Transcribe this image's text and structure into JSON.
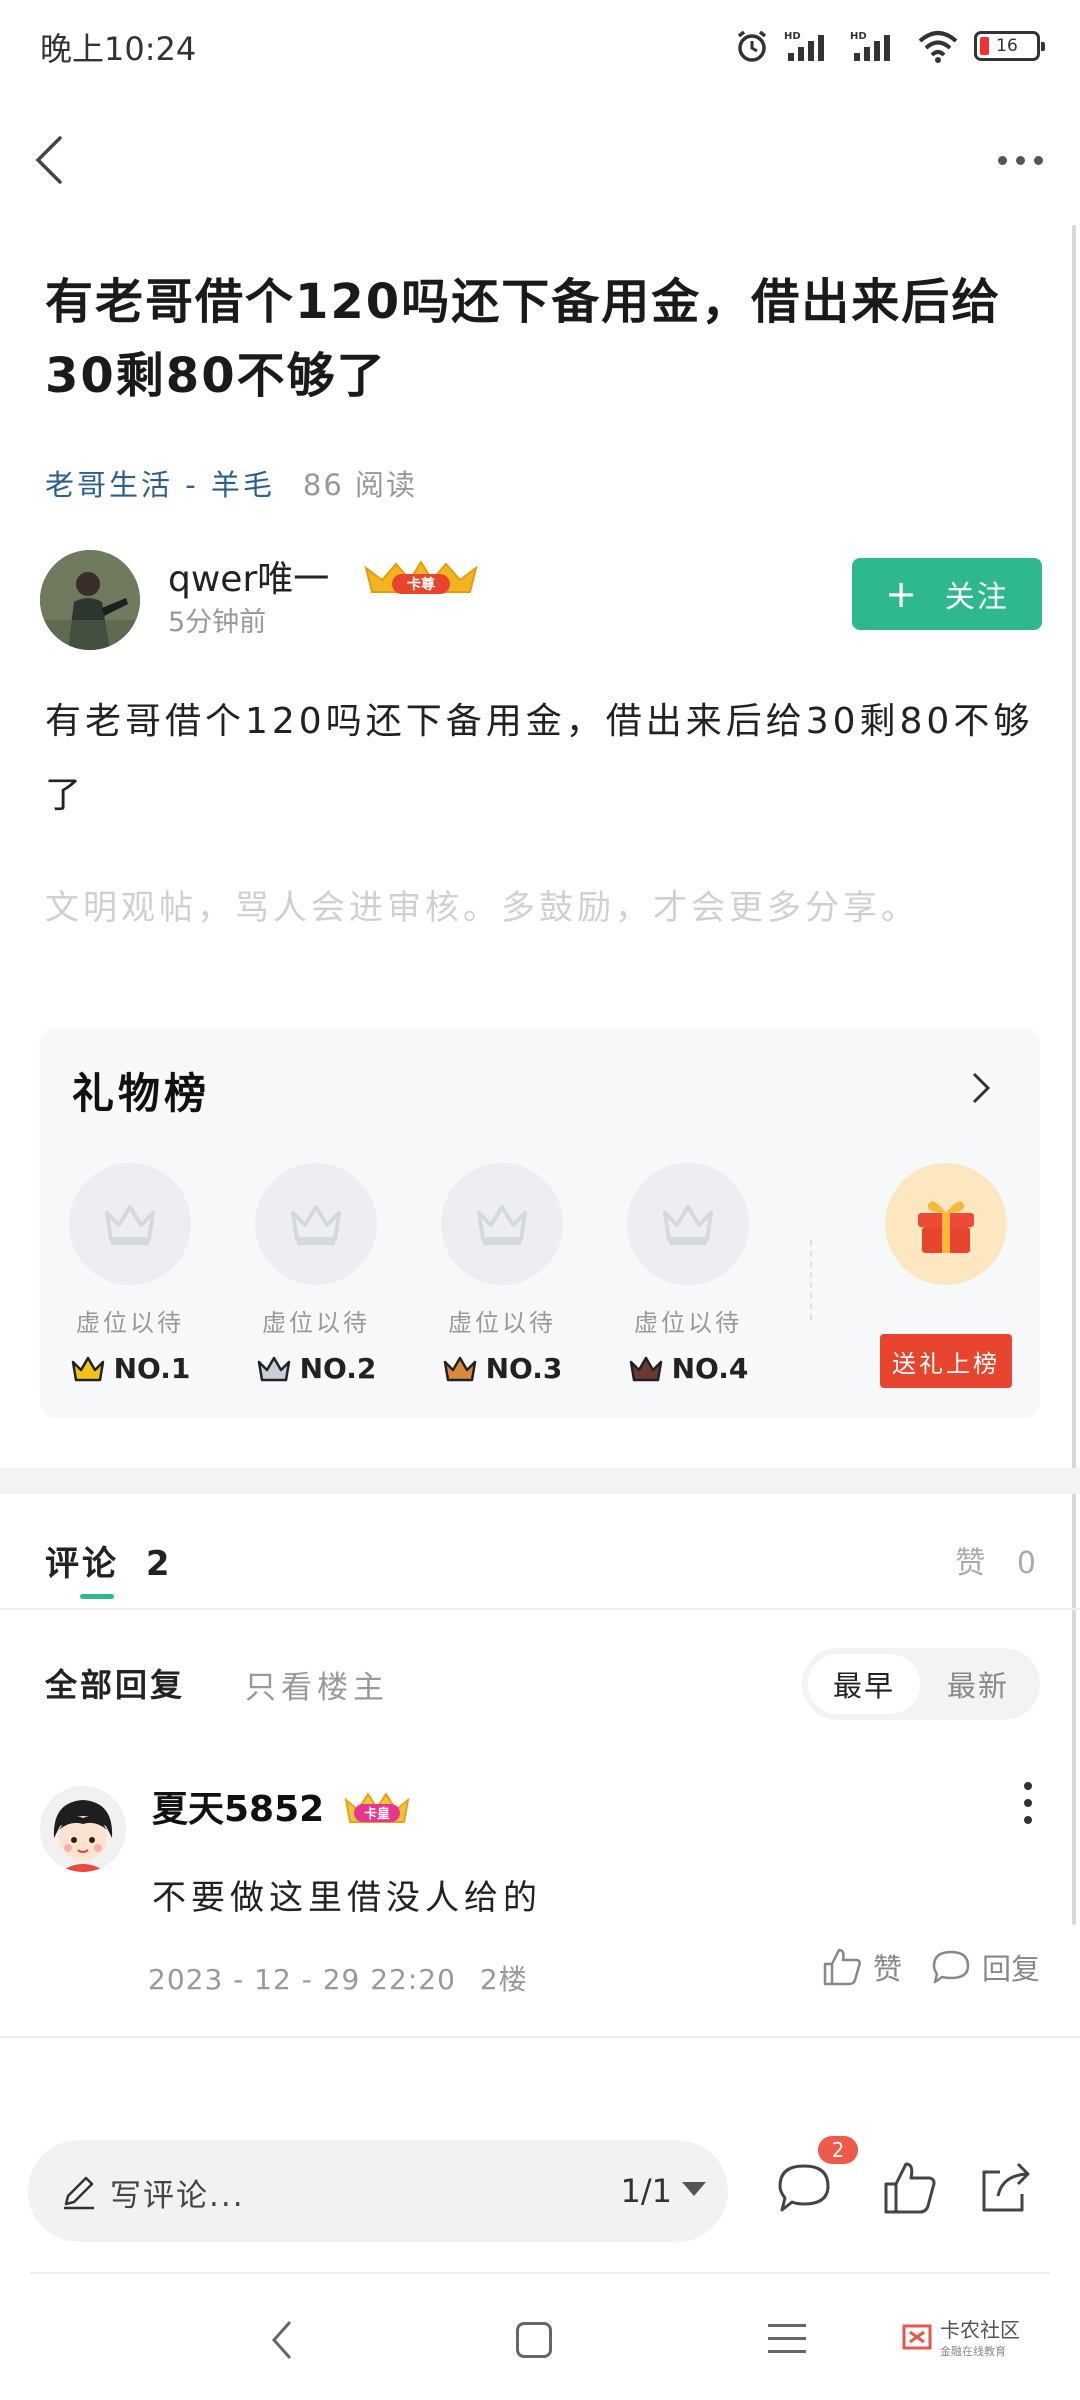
{
  "status_bar": {
    "time": "晚上10:24",
    "battery": "16",
    "icons": [
      "alarm-icon",
      "signal-hd-icon",
      "signal-hd-icon",
      "wifi-icon",
      "battery-icon"
    ]
  },
  "nav": {
    "back_icon": "back-chevron-icon",
    "more_icon": "more-dots-icon"
  },
  "post": {
    "title": "有老哥借个120吗还下备用金，借出来后给30剩80不够了",
    "category": "老哥生活 - 羊毛",
    "reads": "86 阅读",
    "author": "qwer唯一",
    "author_badge": "卡尊",
    "time_ago": "5分钟前",
    "follow_label": "关注",
    "follow_plus": "+",
    "body": "有老哥借个120吗还下备用金，借出来后给30剩80不够了",
    "civility_note": "文明观帖，骂人会进审核。多鼓励，才会更多分享。"
  },
  "gift_board": {
    "title": "礼物榜",
    "slots": [
      {
        "placeholder": "虚位以待",
        "rank": "NO.1",
        "crown_color": "#f3c11b"
      },
      {
        "placeholder": "虚位以待",
        "rank": "NO.2",
        "crown_color": "#c9cfd8"
      },
      {
        "placeholder": "虚位以待",
        "rank": "NO.3",
        "crown_color": "#d88a3c"
      },
      {
        "placeholder": "虚位以待",
        "rank": "NO.4",
        "crown_color": "#6b3a34"
      }
    ],
    "send_label": "送礼上榜"
  },
  "comments": {
    "tab_label": "评论",
    "count": "2",
    "likes_label": "赞",
    "likes_count": "0",
    "filter_all": "全部回复",
    "filter_op": "只看楼主",
    "sort_earliest": "最早",
    "sort_latest": "最新",
    "items": [
      {
        "user": "夏天5852",
        "badge": "卡皇",
        "text": "不要做这里借没人给的",
        "time": "2023 - 12 - 29 22:20",
        "floor": "2楼",
        "like_label": "赞",
        "reply_label": "回复"
      }
    ]
  },
  "bottom_bar": {
    "write_placeholder": "写评论...",
    "page": "1/1",
    "comment_badge": "2"
  },
  "watermark": {
    "main": "卡农社区",
    "sub": "金融在线教育"
  },
  "colors": {
    "accent": "#2fb890",
    "category_link": "#2e5f8a",
    "send_gift": "#e8452f",
    "badge_red": "#ee5a4a"
  }
}
